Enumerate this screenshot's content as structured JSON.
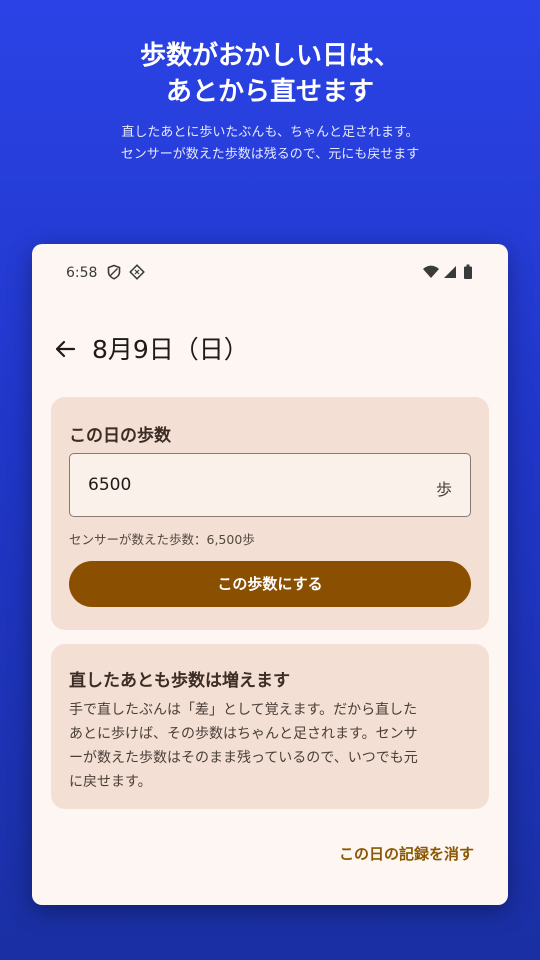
{
  "promo": {
    "title_line1": "歩数がおかしい日は、",
    "title_line2": "あとから直せます",
    "subtitle_line1": "直したあとに歩いたぶんも、ちゃんと足されます。",
    "subtitle_line2": "センサーが数えた歩数は残るので、元にも戻せます"
  },
  "status_bar": {
    "time": "6:58",
    "icons_left": [
      "shield-icon",
      "diamond-icon"
    ],
    "icons_right": [
      "wifi-icon",
      "signal-icon",
      "battery-icon"
    ]
  },
  "app_bar": {
    "back_icon": "arrow-left-icon",
    "title": "8月9日（日）"
  },
  "steps_card": {
    "title": "この日の歩数",
    "input_value": "6500",
    "unit": "歩",
    "sensor_note": "センサーが数えた歩数：6,500歩",
    "apply_button": "この歩数にする"
  },
  "info_card": {
    "title": "直したあとも歩数は増えます",
    "body_lines": [
      "手で直したぶんは「差」として覚えます。だから直した",
      "あとに歩けば、その歩数はちゃんと足されます。センサ",
      "ーが数えた歩数はそのまま残っているので、いつでも元",
      "に戻せます。"
    ]
  },
  "delete_link": "この日の記録を消す",
  "colors": {
    "background_top": "#2b43e6",
    "background_bottom": "#1a2fa3",
    "surface": "#fdf6f2",
    "card": "#f3dfd3",
    "primary_button": "#8a4f00",
    "link": "#8a5800"
  }
}
